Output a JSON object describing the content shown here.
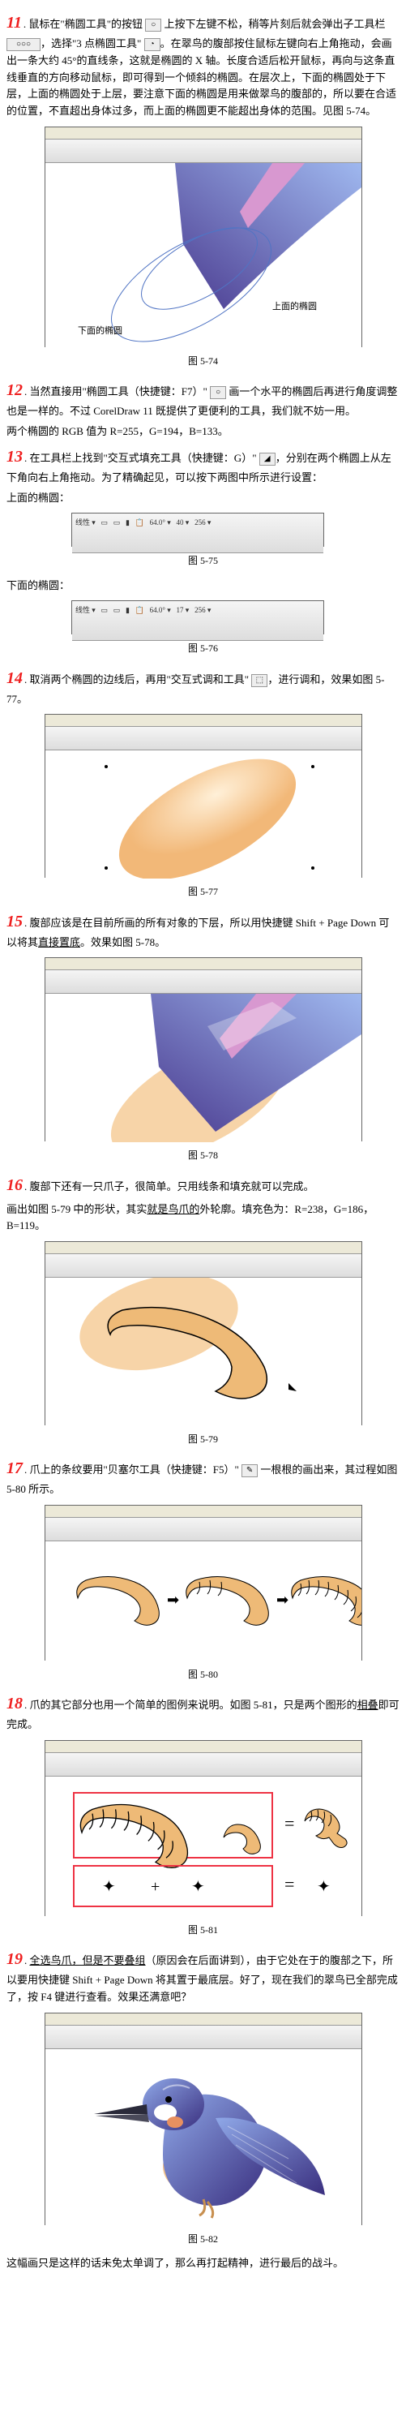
{
  "s11": {
    "text1": ". 鼠标在\"椭圆工具\"的按钮 ",
    "text2": " 上按下左键不松，稍等片刻后就会弹出子工具栏 ",
    "text3": "，选择\"3 点椭圆工具\" ",
    "text4": "。在翠鸟的腹部按住鼠标左键向右上角拖动，会画出一条大约 45°的直线条，这就是椭圆的 X 轴。长度合适后松开鼠标，再向与这条直线垂直的方向移动鼠标，即可得到一个倾斜的椭圆。在层次上，下面的椭圆处于下层，上面的椭圆处于上层，要注意下面的椭圆是用来做翠鸟的腹部的，所以要在合适的位置，不直超出身体过多，而上面的椭圆更不能超出身体的范围。见图 5-74。"
  },
  "cap74": "图 5-74",
  "s12": {
    "text1": ". 当然直接用\"椭圆工具（快捷键：F7）\" ",
    "text2": " 画一个水平的椭圆后再进行角度调整也是一样的。不过 CorelDraw 11 既提供了更便利的工具，我们就不妨一用。",
    "text3": "两个椭圆的 RGB 值为 R=255，G=194，B=133。"
  },
  "s13": {
    "text1": ". 在工具栏上找到\"交互式填充工具（快捷键：G）\" ",
    "text2": "，分别在两个椭圆上从左下角向右上角拖动。为了精确起见，可以按下两图中所示进行设置：",
    "text3": "上面的椭圆："
  },
  "cap75": "图 5-75",
  "s13b": "下面的椭圆：",
  "cap76": "图 5-76",
  "s14": ". 取消两个椭圆的边线后，再用\"交互式调和工具\" ",
  "s14b": "，进行调和，效果如图 5-77。",
  "cap77": "图 5-77",
  "s15": {
    "text1": ". 腹部应该是在目前所画的所有对象的下层，所以用快捷键 Shift + Page Down 可以将其",
    "text2": "直接置底",
    "text3": "。效果如图 5-78。"
  },
  "cap78": "图 5-78",
  "s16": {
    "text1": ". 腹部下还有一只爪子，很简单。只用线条和填充就可以完成。",
    "text2": "画出如图 5-79 中的形状，其实",
    "text2b": "就是鸟爪的",
    "text2c": "外轮廓。填充色为：R=238，G=186，B=119。"
  },
  "cap79": "图 5-79",
  "s17": {
    "text1": ". 爪上的条纹要用\"贝塞尔工具（快捷键：F5）\" ",
    "text2": " 一根根的画出来，其过程如图 5-80 所示。"
  },
  "cap80": "图 5-80",
  "s18": {
    "text1": ". 爪的其它部分也用一个简单的图例来说明。如图 5-81，只是两个图形的",
    "text2": "相叠",
    "text3": "即可完成。"
  },
  "cap81": "图 5-81",
  "s19": {
    "text1": ". ",
    "text2": "全选鸟爪，但是",
    "text3": "不要叠组",
    "text4": "（原因会在后面讲到），由于它处在于的腹部之下，所以要用快捷键 Shift + Page Down 将其置于最底层。好了，现在我们的翠鸟已全部完成了，按 F4 键进行查看。效果还满意吧？"
  },
  "cap82": "图 5-82",
  "closing": "这幅画只是这样的话未免太单调了，那么再打起精神，进行最后的战斗。"
}
